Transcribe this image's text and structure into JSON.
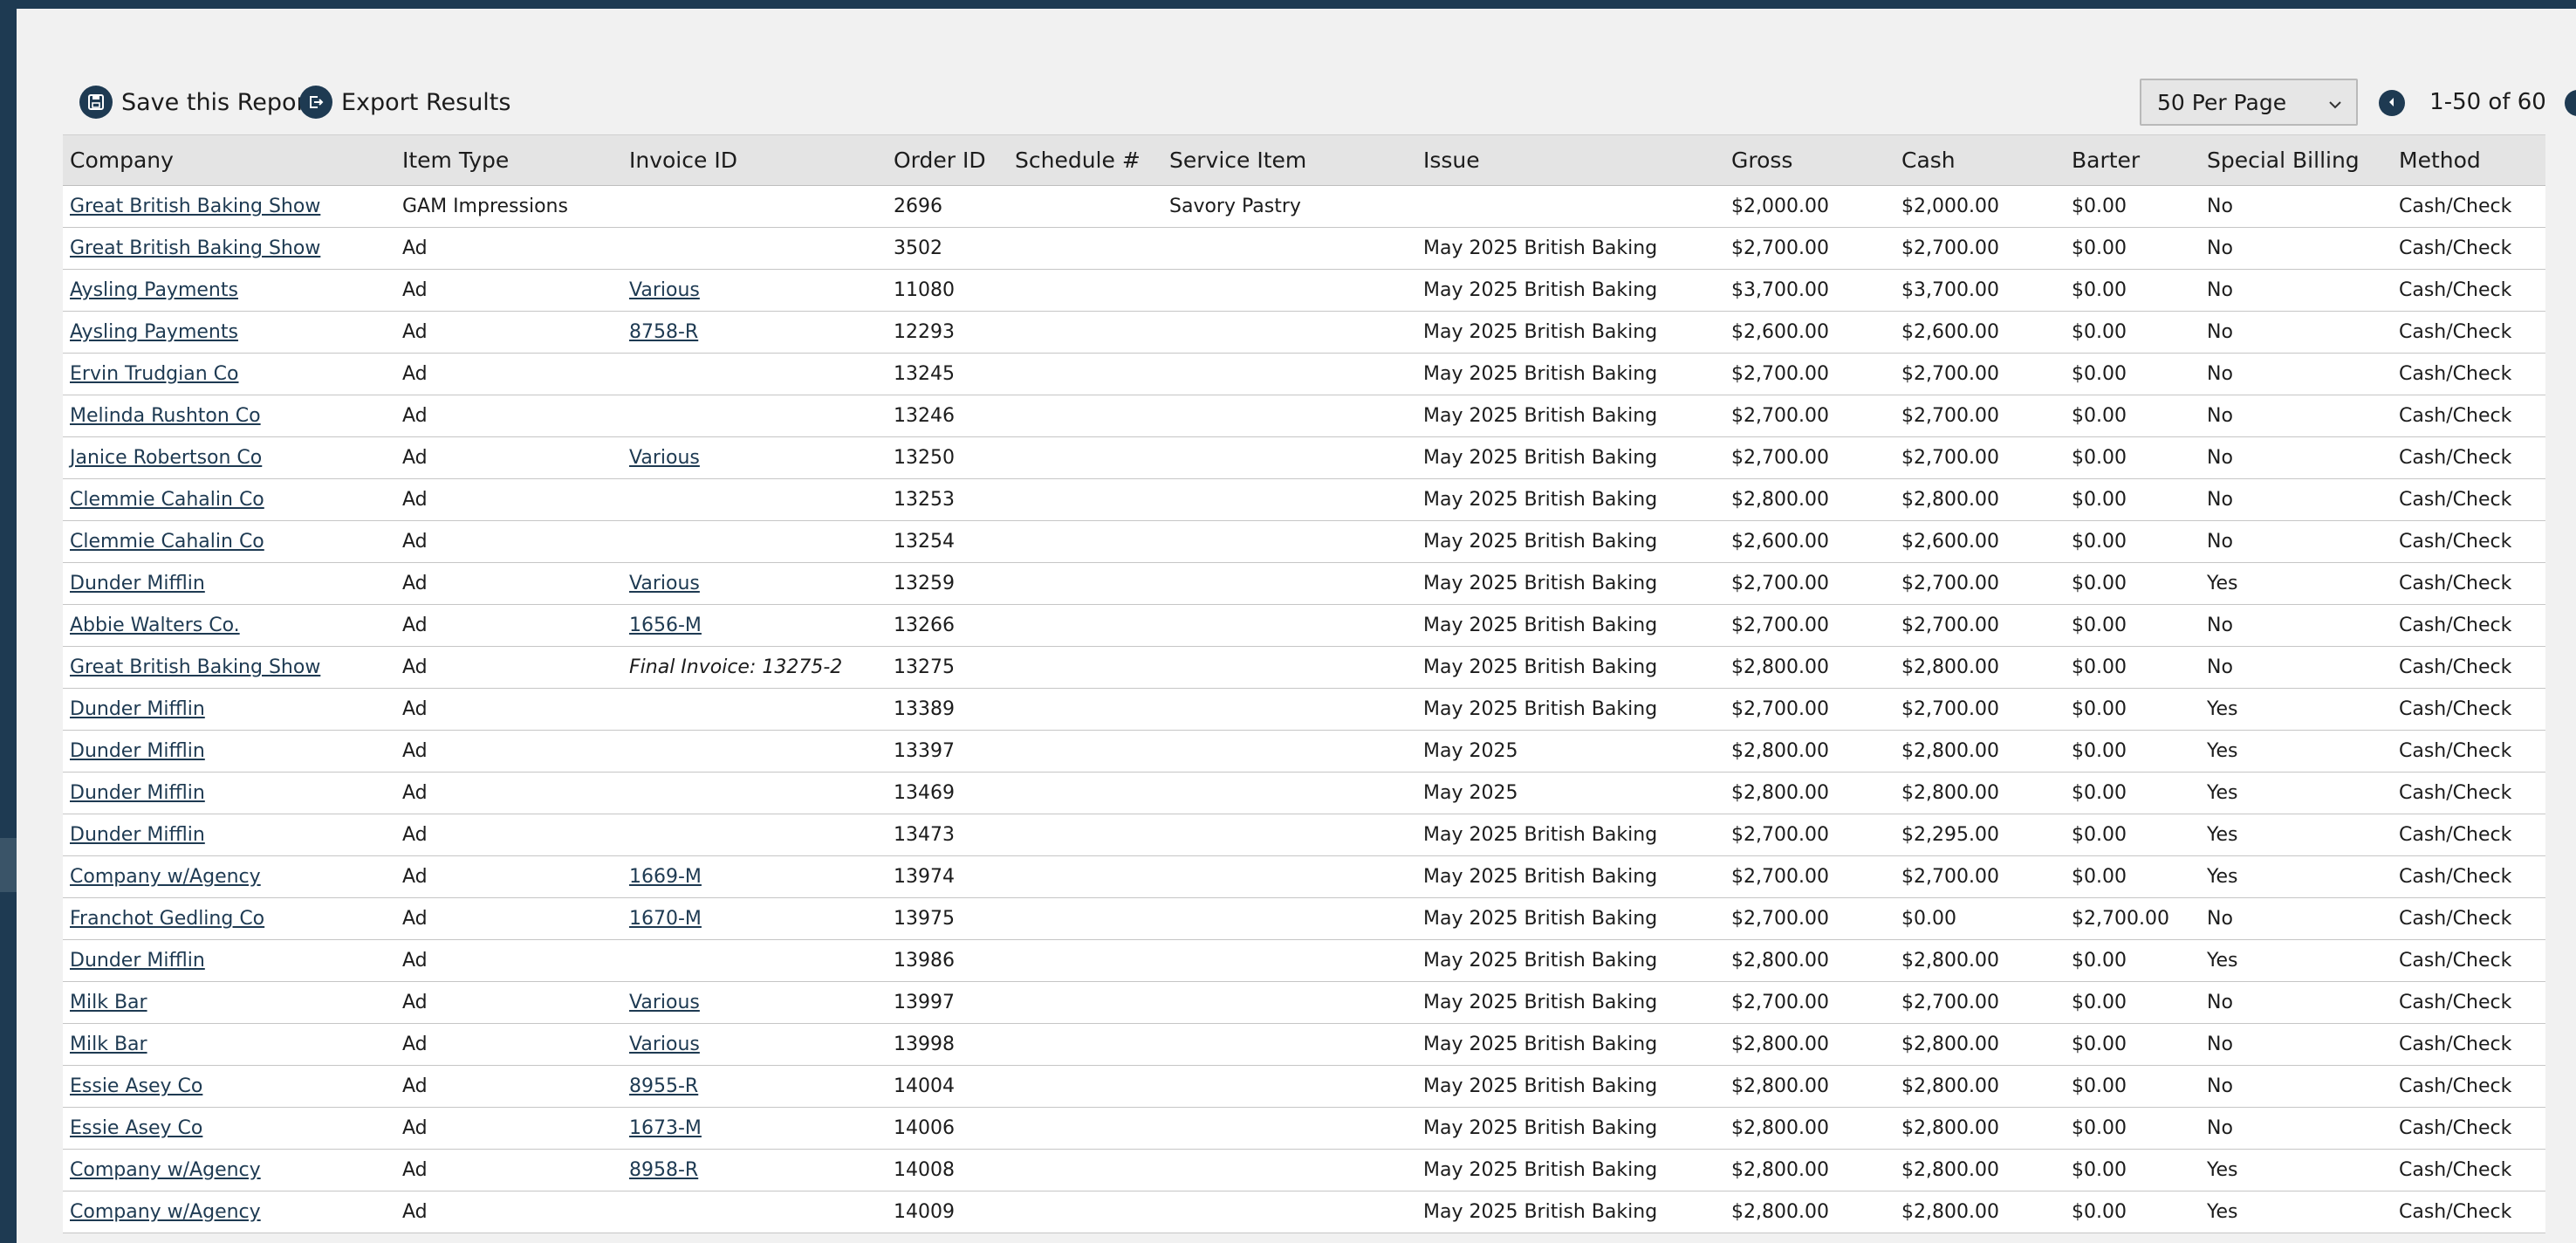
{
  "toolbar": {
    "save_label": "Save this Report",
    "export_label": "Export Results",
    "per_page": "50 Per Page",
    "range": "1-50 of 60"
  },
  "columns": [
    "Company",
    "Item Type",
    "Invoice ID",
    "Order ID",
    "Schedule #",
    "Service Item",
    "Issue",
    "Gross",
    "Cash",
    "Barter",
    "Special Billing",
    "Method"
  ],
  "rows": [
    {
      "company": "Great British Baking Show",
      "item_type": "GAM Impressions",
      "invoice": "",
      "order": "2696",
      "schedule": "",
      "service": "Savory Pastry",
      "issue": "",
      "gross": "$2,000.00",
      "cash": "$2,000.00",
      "barter": "$0.00",
      "special": "No",
      "method": "Cash/Check"
    },
    {
      "company": "Great British Baking Show",
      "item_type": "Ad",
      "invoice": "",
      "order": "3502",
      "schedule": "",
      "service": "",
      "issue": "May 2025 British Baking",
      "gross": "$2,700.00",
      "cash": "$2,700.00",
      "barter": "$0.00",
      "special": "No",
      "method": "Cash/Check"
    },
    {
      "company": "Aysling Payments",
      "item_type": "Ad",
      "invoice": "Various",
      "order": "11080",
      "schedule": "",
      "service": "",
      "issue": "May 2025 British Baking",
      "gross": "$3,700.00",
      "cash": "$3,700.00",
      "barter": "$0.00",
      "special": "No",
      "method": "Cash/Check"
    },
    {
      "company": "Aysling Payments",
      "item_type": "Ad",
      "invoice": "8758-R",
      "order": "12293",
      "schedule": "",
      "service": "",
      "issue": "May 2025 British Baking",
      "gross": "$2,600.00",
      "cash": "$2,600.00",
      "barter": "$0.00",
      "special": "No",
      "method": "Cash/Check"
    },
    {
      "company": "Ervin Trudgian Co",
      "item_type": "Ad",
      "invoice": "",
      "order": "13245",
      "schedule": "",
      "service": "",
      "issue": "May 2025 British Baking",
      "gross": "$2,700.00",
      "cash": "$2,700.00",
      "barter": "$0.00",
      "special": "No",
      "method": "Cash/Check"
    },
    {
      "company": "Melinda Rushton Co",
      "item_type": "Ad",
      "invoice": "",
      "order": "13246",
      "schedule": "",
      "service": "",
      "issue": "May 2025 British Baking",
      "gross": "$2,700.00",
      "cash": "$2,700.00",
      "barter": "$0.00",
      "special": "No",
      "method": "Cash/Check"
    },
    {
      "company": "Janice Robertson Co",
      "item_type": "Ad",
      "invoice": "Various",
      "order": "13250",
      "schedule": "",
      "service": "",
      "issue": "May 2025 British Baking",
      "gross": "$2,700.00",
      "cash": "$2,700.00",
      "barter": "$0.00",
      "special": "No",
      "method": "Cash/Check"
    },
    {
      "company": "Clemmie Cahalin Co",
      "item_type": "Ad",
      "invoice": "",
      "order": "13253",
      "schedule": "",
      "service": "",
      "issue": "May 2025 British Baking",
      "gross": "$2,800.00",
      "cash": "$2,800.00",
      "barter": "$0.00",
      "special": "No",
      "method": "Cash/Check"
    },
    {
      "company": "Clemmie Cahalin Co",
      "item_type": "Ad",
      "invoice": "",
      "order": "13254",
      "schedule": "",
      "service": "",
      "issue": "May 2025 British Baking",
      "gross": "$2,600.00",
      "cash": "$2,600.00",
      "barter": "$0.00",
      "special": "No",
      "method": "Cash/Check"
    },
    {
      "company": "Dunder Mifflin",
      "item_type": "Ad",
      "invoice": "Various",
      "order": "13259",
      "schedule": "",
      "service": "",
      "issue": "May 2025 British Baking",
      "gross": "$2,700.00",
      "cash": "$2,700.00",
      "barter": "$0.00",
      "special": "Yes",
      "method": "Cash/Check"
    },
    {
      "company": "Abbie Walters Co.",
      "item_type": "Ad",
      "invoice": "1656-M",
      "order": "13266",
      "schedule": "",
      "service": "",
      "issue": "May 2025 British Baking",
      "gross": "$2,700.00",
      "cash": "$2,700.00",
      "barter": "$0.00",
      "special": "No",
      "method": "Cash/Check"
    },
    {
      "company": "Great British Baking Show",
      "item_type": "Ad",
      "invoice": "Final Invoice: 13275-2",
      "invoice_italic": true,
      "order": "13275",
      "schedule": "",
      "service": "",
      "issue": "May 2025 British Baking",
      "gross": "$2,800.00",
      "cash": "$2,800.00",
      "barter": "$0.00",
      "special": "No",
      "method": "Cash/Check"
    },
    {
      "company": "Dunder Mifflin",
      "item_type": "Ad",
      "invoice": "",
      "order": "13389",
      "schedule": "",
      "service": "",
      "issue": "May 2025 British Baking",
      "gross": "$2,700.00",
      "cash": "$2,700.00",
      "barter": "$0.00",
      "special": "Yes",
      "method": "Cash/Check"
    },
    {
      "company": "Dunder Mifflin",
      "item_type": "Ad",
      "invoice": "",
      "order": "13397",
      "schedule": "",
      "service": "",
      "issue": "May 2025",
      "gross": "$2,800.00",
      "cash": "$2,800.00",
      "barter": "$0.00",
      "special": "Yes",
      "method": "Cash/Check"
    },
    {
      "company": "Dunder Mifflin",
      "item_type": "Ad",
      "invoice": "",
      "order": "13469",
      "schedule": "",
      "service": "",
      "issue": "May 2025",
      "gross": "$2,800.00",
      "cash": "$2,800.00",
      "barter": "$0.00",
      "special": "Yes",
      "method": "Cash/Check"
    },
    {
      "company": "Dunder Mifflin",
      "item_type": "Ad",
      "invoice": "",
      "order": "13473",
      "schedule": "",
      "service": "",
      "issue": "May 2025 British Baking",
      "gross": "$2,700.00",
      "cash": "$2,295.00",
      "barter": "$0.00",
      "special": "Yes",
      "method": "Cash/Check"
    },
    {
      "company": "Company w/Agency",
      "item_type": "Ad",
      "invoice": "1669-M",
      "order": "13974",
      "schedule": "",
      "service": "",
      "issue": "May 2025 British Baking",
      "gross": "$2,700.00",
      "cash": "$2,700.00",
      "barter": "$0.00",
      "special": "Yes",
      "method": "Cash/Check"
    },
    {
      "company": "Franchot Gedling Co",
      "item_type": "Ad",
      "invoice": "1670-M",
      "order": "13975",
      "schedule": "",
      "service": "",
      "issue": "May 2025 British Baking",
      "gross": "$2,700.00",
      "cash": "$0.00",
      "barter": "$2,700.00",
      "special": "No",
      "method": "Cash/Check"
    },
    {
      "company": "Dunder Mifflin",
      "item_type": "Ad",
      "invoice": "",
      "order": "13986",
      "schedule": "",
      "service": "",
      "issue": "May 2025 British Baking",
      "gross": "$2,800.00",
      "cash": "$2,800.00",
      "barter": "$0.00",
      "special": "Yes",
      "method": "Cash/Check"
    },
    {
      "company": "Milk Bar",
      "item_type": "Ad",
      "invoice": "Various",
      "order": "13997",
      "schedule": "",
      "service": "",
      "issue": "May 2025 British Baking",
      "gross": "$2,700.00",
      "cash": "$2,700.00",
      "barter": "$0.00",
      "special": "No",
      "method": "Cash/Check"
    },
    {
      "company": "Milk Bar",
      "item_type": "Ad",
      "invoice": "Various",
      "order": "13998",
      "schedule": "",
      "service": "",
      "issue": "May 2025 British Baking",
      "gross": "$2,800.00",
      "cash": "$2,800.00",
      "barter": "$0.00",
      "special": "No",
      "method": "Cash/Check"
    },
    {
      "company": "Essie Asey Co",
      "item_type": "Ad",
      "invoice": "8955-R",
      "order": "14004",
      "schedule": "",
      "service": "",
      "issue": "May 2025 British Baking",
      "gross": "$2,800.00",
      "cash": "$2,800.00",
      "barter": "$0.00",
      "special": "No",
      "method": "Cash/Check"
    },
    {
      "company": "Essie Asey Co",
      "item_type": "Ad",
      "invoice": "1673-M",
      "order": "14006",
      "schedule": "",
      "service": "",
      "issue": "May 2025 British Baking",
      "gross": "$2,800.00",
      "cash": "$2,800.00",
      "barter": "$0.00",
      "special": "No",
      "method": "Cash/Check"
    },
    {
      "company": "Company w/Agency",
      "item_type": "Ad",
      "invoice": "8958-R",
      "order": "14008",
      "schedule": "",
      "service": "",
      "issue": "May 2025 British Baking",
      "gross": "$2,800.00",
      "cash": "$2,800.00",
      "barter": "$0.00",
      "special": "Yes",
      "method": "Cash/Check"
    },
    {
      "company": "Company w/Agency",
      "item_type": "Ad",
      "invoice": "",
      "order": "14009",
      "schedule": "",
      "service": "",
      "issue": "May 2025 British Baking",
      "gross": "$2,800.00",
      "cash": "$2,800.00",
      "barter": "$0.00",
      "special": "Yes",
      "method": "Cash/Check"
    }
  ],
  "icons": {
    "save": "save-disk-icon",
    "export": "export-icon",
    "prev": "chevron-left-icon",
    "next": "chevron-right-icon",
    "dropdown": "chevron-down-icon"
  },
  "colors": {
    "brand": "#1e3a52",
    "link": "#1e3a52",
    "header_bg": "#e4e4e4",
    "row_bg": "#ffffff"
  }
}
